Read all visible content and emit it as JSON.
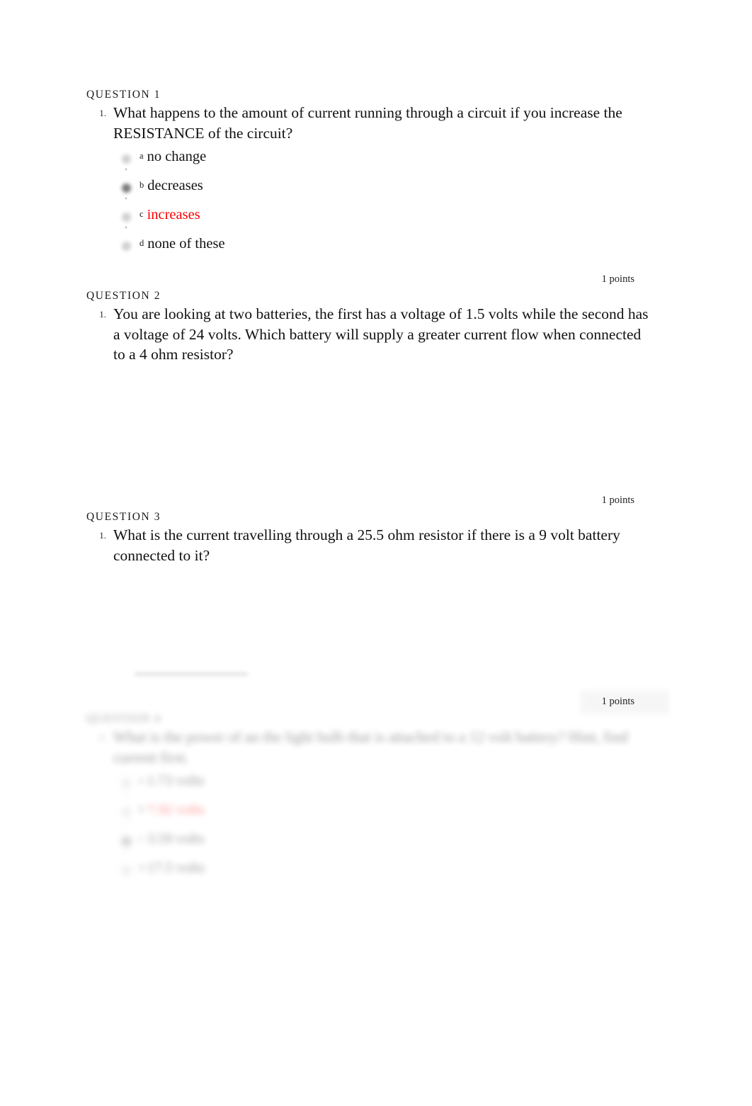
{
  "document": {
    "type": "quiz-review",
    "points_label": "1 points",
    "correct_answer_color": "#ff0000"
  },
  "questions": [
    {
      "header": "QUESTION 1",
      "number": "1.",
      "text": "What happens to the amount of current running through a circuit if you increase the RESISTANCE of the circuit?",
      "points": "1 points",
      "answers": [
        {
          "letter": "a",
          "text": "no change",
          "correct": false,
          "selected": false
        },
        {
          "letter": "b",
          "text": "decreases",
          "correct": false,
          "selected": true
        },
        {
          "letter": "c",
          "text": "increases",
          "correct": true,
          "selected": false
        },
        {
          "letter": "d",
          "text": "none of these",
          "correct": false,
          "selected": false
        }
      ]
    },
    {
      "header": "QUESTION 2",
      "number": "1.",
      "text": "You are looking at two batteries, the first has a voltage of 1.5 volts while the second has a voltage of 24 volts. Which battery will supply a greater current flow when connected to a 4 ohm resistor?",
      "points": "1 points",
      "answers": []
    },
    {
      "header": "QUESTION 3",
      "number": "1.",
      "text": "What is the current travelling through a 25.5 ohm resistor if there is a 9 volt battery connected to it?",
      "points": "1 points",
      "answers": []
    },
    {
      "header": "QUESTION 4",
      "number": "1.",
      "text": "What is the power of an the light bulb that is attached to a 12 volt battery? Hint, find current first.",
      "points": "1 points",
      "answers": [
        {
          "letter": "a",
          "text": "1.73 volts",
          "correct": false,
          "selected": false
        },
        {
          "letter": "b",
          "text": "7.92 volts",
          "correct": true,
          "selected": false
        },
        {
          "letter": "c",
          "text": "3.59 volts",
          "correct": false,
          "selected": true
        },
        {
          "letter": "d",
          "text": "17.5 volts",
          "correct": false,
          "selected": false
        }
      ]
    }
  ]
}
